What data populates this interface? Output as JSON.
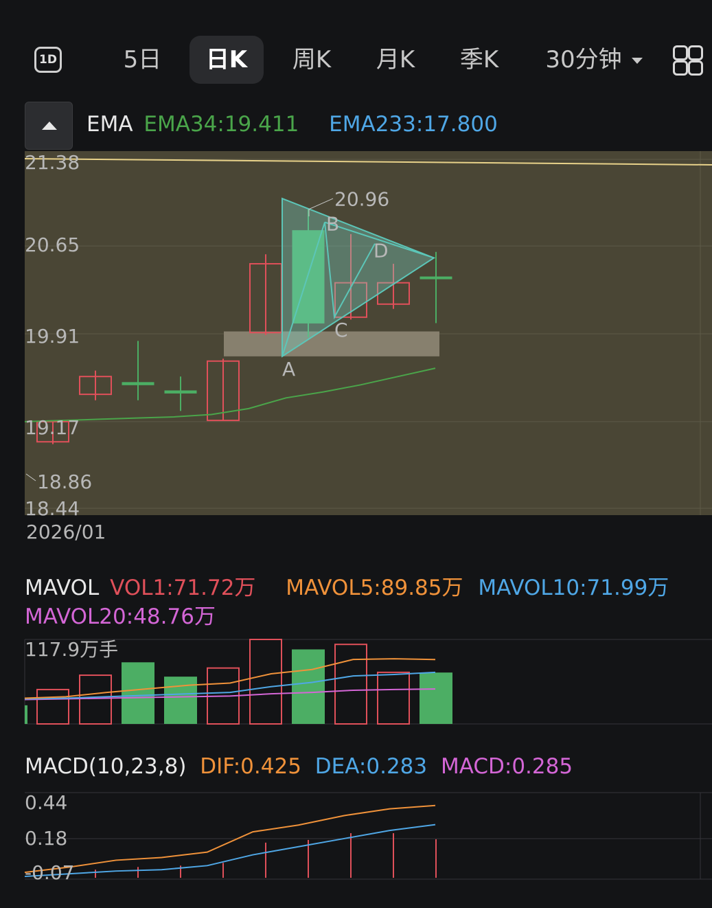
{
  "tabs": {
    "icon_1d": "1D",
    "items": [
      "5日",
      "日K",
      "周K",
      "月K",
      "季K",
      "30分钟"
    ],
    "active": "日K"
  },
  "ema": {
    "label": "EMA",
    "ema34": "EMA34:19.411",
    "ema233": "EMA233:17.800",
    "colors": {
      "ema34": "#4aa54a",
      "ema233": "#4fa7e6"
    }
  },
  "price_axis": [
    "21.38",
    "20.65",
    "19.91",
    "19.17",
    "18.44"
  ],
  "annotations": {
    "high": "20.96",
    "low": "18.86",
    "points": [
      "A",
      "B",
      "C",
      "D"
    ]
  },
  "date_label": "2026/01",
  "mavol": {
    "label": "MAVOL",
    "vol1": "VOL1:71.72万",
    "mavol5": "MAVOL5:89.85万",
    "mavol10": "MAVOL10:71.99万",
    "mavol20": "MAVOL20:48.76万",
    "axis_max": "117.9万手",
    "colors": {
      "vol1": "#e0505a",
      "mavol5": "#f0923a",
      "mavol10": "#4fa7e6",
      "mavol20": "#d466d6"
    }
  },
  "macd": {
    "label": "MACD(10,23,8)",
    "dif": "DIF:0.425",
    "dea": "DEA:0.283",
    "macd": "MACD:0.285",
    "axis": [
      "0.44",
      "0.18",
      "-0.07"
    ],
    "colors": {
      "dif": "#f0923a",
      "dea": "#4fa7e6",
      "macd": "#d466d6"
    }
  },
  "chart_data": {
    "type": "candlestick",
    "ylim": [
      18.44,
      21.38
    ],
    "candles": [
      {
        "open": 19.0,
        "close": 19.17,
        "high": 19.17,
        "low": 18.98,
        "dir": "up"
      },
      {
        "open": 19.4,
        "close": 19.55,
        "high": 19.6,
        "low": 19.35,
        "dir": "up"
      },
      {
        "open": 19.5,
        "close": 19.48,
        "high": 19.85,
        "low": 19.35,
        "dir": "down"
      },
      {
        "open": 19.43,
        "close": 19.41,
        "high": 19.55,
        "low": 19.26,
        "dir": "down"
      },
      {
        "open": 19.18,
        "close": 19.68,
        "high": 19.7,
        "low": 19.18,
        "dir": "up"
      },
      {
        "open": 19.92,
        "close": 20.5,
        "high": 20.58,
        "low": 19.9,
        "dir": "up"
      },
      {
        "open": 20.78,
        "close": 20.0,
        "high": 20.96,
        "low": 19.88,
        "dir": "down"
      },
      {
        "open": 20.05,
        "close": 20.34,
        "high": 20.75,
        "low": 20.03,
        "dir": "up"
      },
      {
        "open": 20.16,
        "close": 20.34,
        "high": 20.5,
        "low": 20.12,
        "dir": "up"
      },
      {
        "open": 20.39,
        "close": 20.38,
        "high": 20.6,
        "low": 20.0,
        "dir": "down"
      }
    ],
    "ema34_line": [
      19.17,
      19.18,
      19.19,
      19.2,
      19.21,
      19.23,
      19.28,
      19.37,
      19.42,
      19.48,
      19.55,
      19.62
    ],
    "volume": {
      "ylim": [
        0,
        117.9
      ],
      "bars": [
        {
          "value": 48,
          "dir": "up"
        },
        {
          "value": 68,
          "dir": "up"
        },
        {
          "value": 86,
          "dir": "down"
        },
        {
          "value": 66,
          "dir": "down"
        },
        {
          "value": 78,
          "dir": "up"
        },
        {
          "value": 117.9,
          "dir": "up"
        },
        {
          "value": 104,
          "dir": "down"
        },
        {
          "value": 111,
          "dir": "up"
        },
        {
          "value": 72,
          "dir": "up"
        },
        {
          "value": 71.72,
          "dir": "down"
        }
      ],
      "mavol5": [
        36,
        38,
        44,
        49,
        54,
        57,
        70,
        76,
        90,
        91,
        89.85
      ],
      "mavol10": [
        35,
        36,
        38,
        40,
        42,
        44,
        52,
        58,
        67,
        69,
        71.99
      ],
      "mavol20": [
        34,
        35,
        36,
        37,
        38,
        39,
        42,
        44,
        47,
        48,
        48.76
      ]
    },
    "macd_panel": {
      "ylim": [
        -0.12,
        0.52
      ],
      "dif": [
        -0.07,
        -0.03,
        0.02,
        0.04,
        0.08,
        0.23,
        0.28,
        0.35,
        0.4,
        0.425
      ],
      "dea": [
        -0.1,
        -0.08,
        -0.06,
        -0.05,
        -0.02,
        0.06,
        0.12,
        0.18,
        0.24,
        0.283
      ],
      "hist": [
        0.0,
        0.06,
        0.08,
        0.09,
        0.11,
        0.26,
        0.28,
        0.33,
        0.33,
        0.285
      ]
    }
  }
}
